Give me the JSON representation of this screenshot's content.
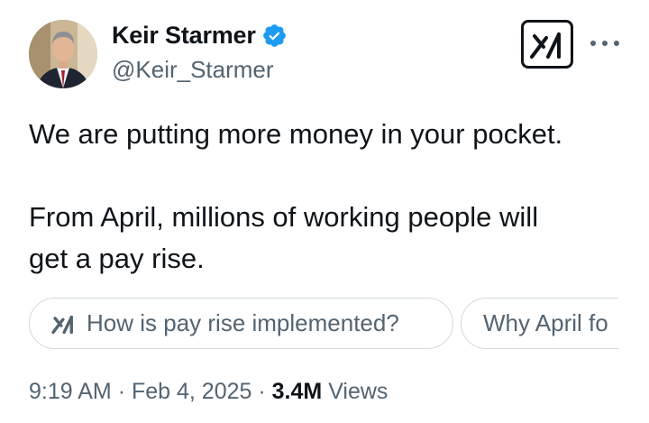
{
  "author": {
    "name": "Keir Starmer",
    "handle": "@Keir_Starmer",
    "verified": true,
    "avatar_icon": "profile-photo"
  },
  "header_actions": {
    "grok_icon": "grok-icon",
    "more_icon": "more-horizontal-icon"
  },
  "tweet": {
    "paragraph1": "We are putting more money in your pocket.",
    "paragraph2_line1": "From April, millions of working people will",
    "paragraph2_line2": "get a pay rise."
  },
  "grok_suggestions": [
    {
      "label": "How is pay rise implemented?",
      "icon": "grok-icon"
    },
    {
      "label": "Why April fo"
    }
  ],
  "meta": {
    "time": "9:19 AM",
    "separator": "·",
    "date": "Feb 4, 2025",
    "views_count": "3.4M",
    "views_label": "Views"
  },
  "colors": {
    "text_primary": "#0f1419",
    "text_secondary": "#536471",
    "verified_blue": "#1d9bf0",
    "chip_border": "#cfd9de"
  }
}
